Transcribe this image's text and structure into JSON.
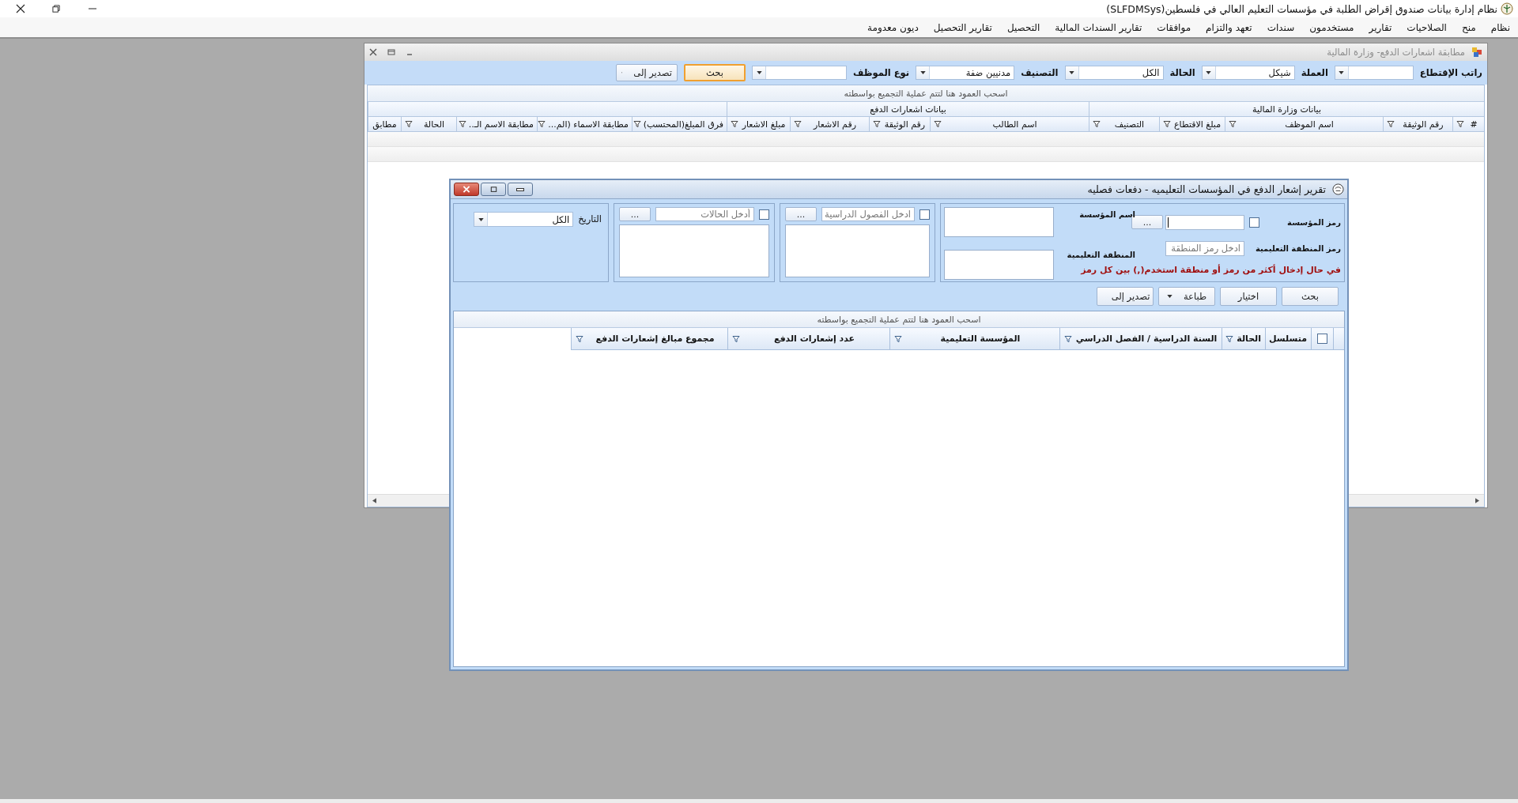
{
  "app": {
    "title": "نظام إدارة بيانات صندوق إقراض الطلبة في مؤسسات التعليم العالي في فلسطين(SLFDMSys)",
    "menu": [
      "نظام",
      "منح",
      "الصلاحيات",
      "تقارير",
      "مستخدمون",
      "سندات",
      "تعهد والتزام",
      "موافقات",
      "تقارير السندات المالية",
      "التحصيل",
      "تقارير التحصيل",
      "ديون معدومة"
    ]
  },
  "back_window": {
    "title": "مطابقة اشعارات الدفع- وزارة المالية",
    "filters": [
      {
        "label": "راتب الإقتطاع"
      },
      {
        "label": "العملة",
        "value": "شيكل"
      },
      {
        "label": "الحالة",
        "value": "الكل"
      },
      {
        "label": "التصنيف",
        "value": "مدنيين ضفة"
      },
      {
        "label": "نوع الموظف"
      }
    ],
    "buttons": [
      {
        "kind": "button",
        "label": "بحث",
        "focused": true
      },
      {
        "kind": "dropdown",
        "label": "تصدير إلى",
        "focused": false
      }
    ],
    "group_panel": "اسحب العمود هنا لتتم عملية التجميع بواسطته",
    "bands": [
      "بيانات وزارة المالية",
      "بيانات اشعارات الدفع"
    ],
    "columns": [
      {
        "label": "#",
        "filter": true
      },
      {
        "label": "رقم الوثيقة",
        "filter": true
      },
      {
        "label": "اسم الموظف",
        "filter": true
      },
      {
        "label": "مبلغ الاقتطاع",
        "filter": true
      },
      {
        "label": "التصنيف",
        "filter": true
      },
      {
        "label": "اسم الطالب",
        "filter": true
      },
      {
        "label": "رقم الوثيقة",
        "filter": true
      },
      {
        "label": "رقم الاشعار",
        "filter": true
      },
      {
        "label": "مبلغ الاشعار",
        "filter": true
      },
      {
        "label": "فرق المبلغ(المحتسب)",
        "filter": true
      },
      {
        "label": "مطابقة الاسماء (الم...",
        "filter": true
      },
      {
        "label": "مطابقة الاسم الـ..",
        "filter": true
      },
      {
        "label": "الحالة",
        "filter": true
      },
      {
        "label": "مطابق",
        "filter": false
      }
    ]
  },
  "dialog": {
    "title": "تقرير إشعار الدفع في المؤسسات التعليميه - دفعات فصليه",
    "institution": {
      "code_label": "رمز المؤسسة",
      "code_checked": false,
      "code_focused": true,
      "browse": "...",
      "name_label": "اسم المؤسسة",
      "region_label": "رمز  المنطقة التعليمية",
      "region_placeholder": "ادخل رمز المنطقة",
      "region_name_label": "المنطقة التعليمية",
      "note": "في حال إدخال أكثر من رمز أو منطقة استخدم(,) بين كل رمز"
    },
    "pickers": [
      {
        "placeholder": "ادخل الفصول الدراسية",
        "checked": false,
        "browse": "..."
      },
      {
        "placeholder": "أدخل الحالات",
        "checked": false,
        "browse": "..."
      }
    ],
    "date": {
      "label": "التاريخ",
      "value": "الكل"
    },
    "buttons": [
      {
        "kind": "button",
        "label": "بحث"
      },
      {
        "kind": "button",
        "label": "اختيار"
      },
      {
        "kind": "dropdown",
        "label": "طباعة"
      },
      {
        "kind": "dropdown",
        "label": "تصدير إلى"
      }
    ],
    "group_panel": "اسحب العمود هنا لتتم عملية التجميع بواسطته",
    "select_all_checked": false,
    "columns": [
      {
        "label": "متسلسل",
        "filter": false
      },
      {
        "label": "الحالة",
        "filter": true
      },
      {
        "label": "السنة الدراسية / الفصل الدراسي",
        "filter": true
      },
      {
        "label": "المؤسسة التعليمية",
        "filter": true
      },
      {
        "label": "عدد إشعارات الدفع",
        "filter": true
      },
      {
        "label": "مجموع مبالغ إشعارات الدفع",
        "filter": true
      }
    ]
  }
}
